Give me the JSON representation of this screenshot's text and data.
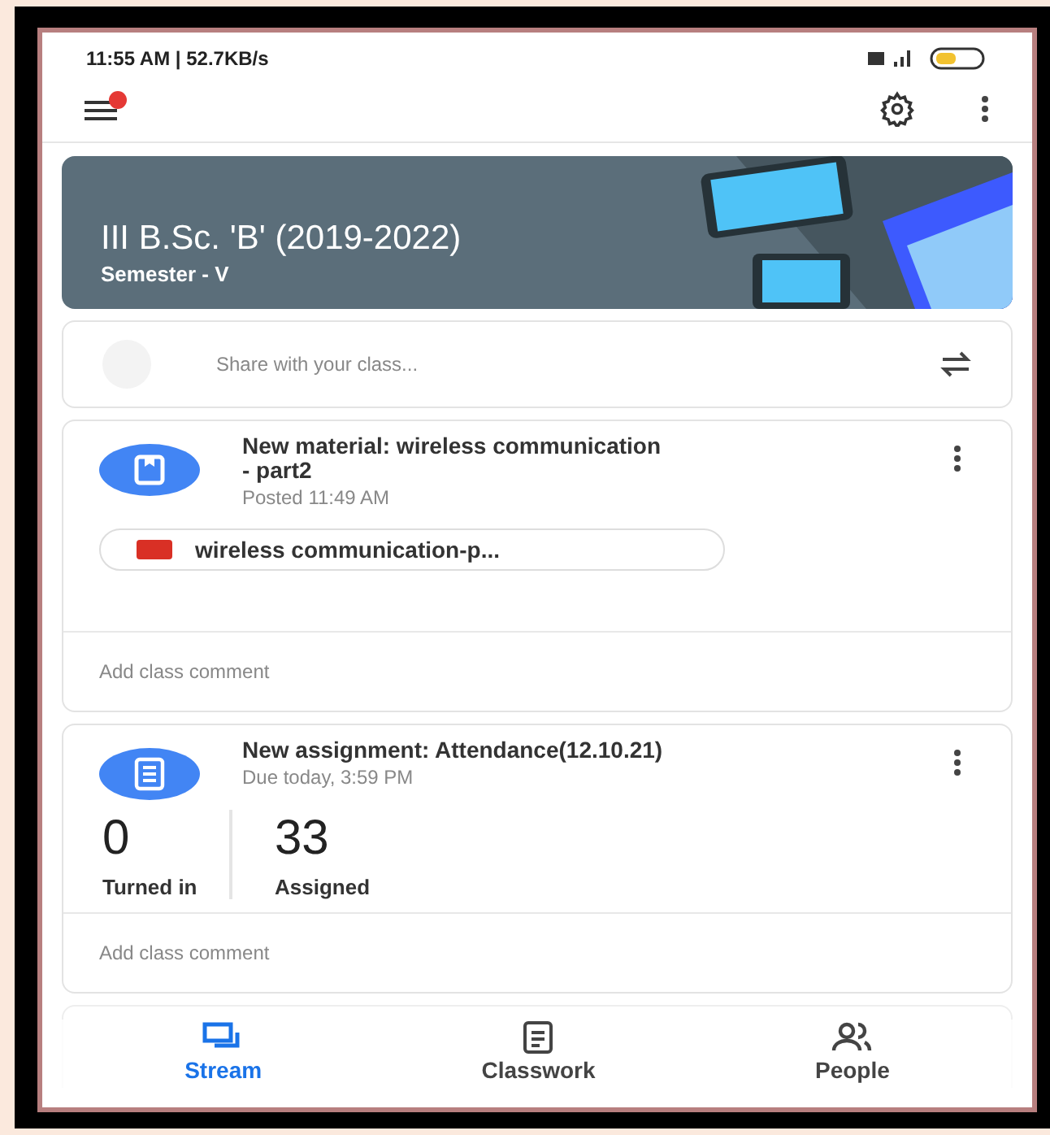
{
  "status_bar": {
    "time_info": "11:55 AM | 52.7KB/s"
  },
  "toolbar": {
    "has_notification": true
  },
  "banner": {
    "title": "III B.Sc. 'B' (2019-2022)",
    "subtitle": "Semester - V"
  },
  "share": {
    "placeholder": "Share with your class..."
  },
  "posts": [
    {
      "kind": "material",
      "title": "New material: wireless communication - part2",
      "meta": "Posted 11:49 AM",
      "attachment": "wireless communication-p...",
      "comment_placeholder": "Add class comment"
    },
    {
      "kind": "assignment",
      "title": "New assignment: Attendance(12.10.21)",
      "meta": "Due today, 3:59 PM",
      "stats": [
        {
          "value": "0",
          "label": "Turned in"
        },
        {
          "value": "33",
          "label": "Assigned"
        }
      ],
      "comment_placeholder": "Add class comment"
    }
  ],
  "nav_tabs": [
    {
      "kind": "stream",
      "label": "Stream",
      "selected": true
    },
    {
      "kind": "classwork",
      "label": "Classwork",
      "selected": false
    },
    {
      "kind": "people",
      "label": "People",
      "selected": false
    }
  ]
}
